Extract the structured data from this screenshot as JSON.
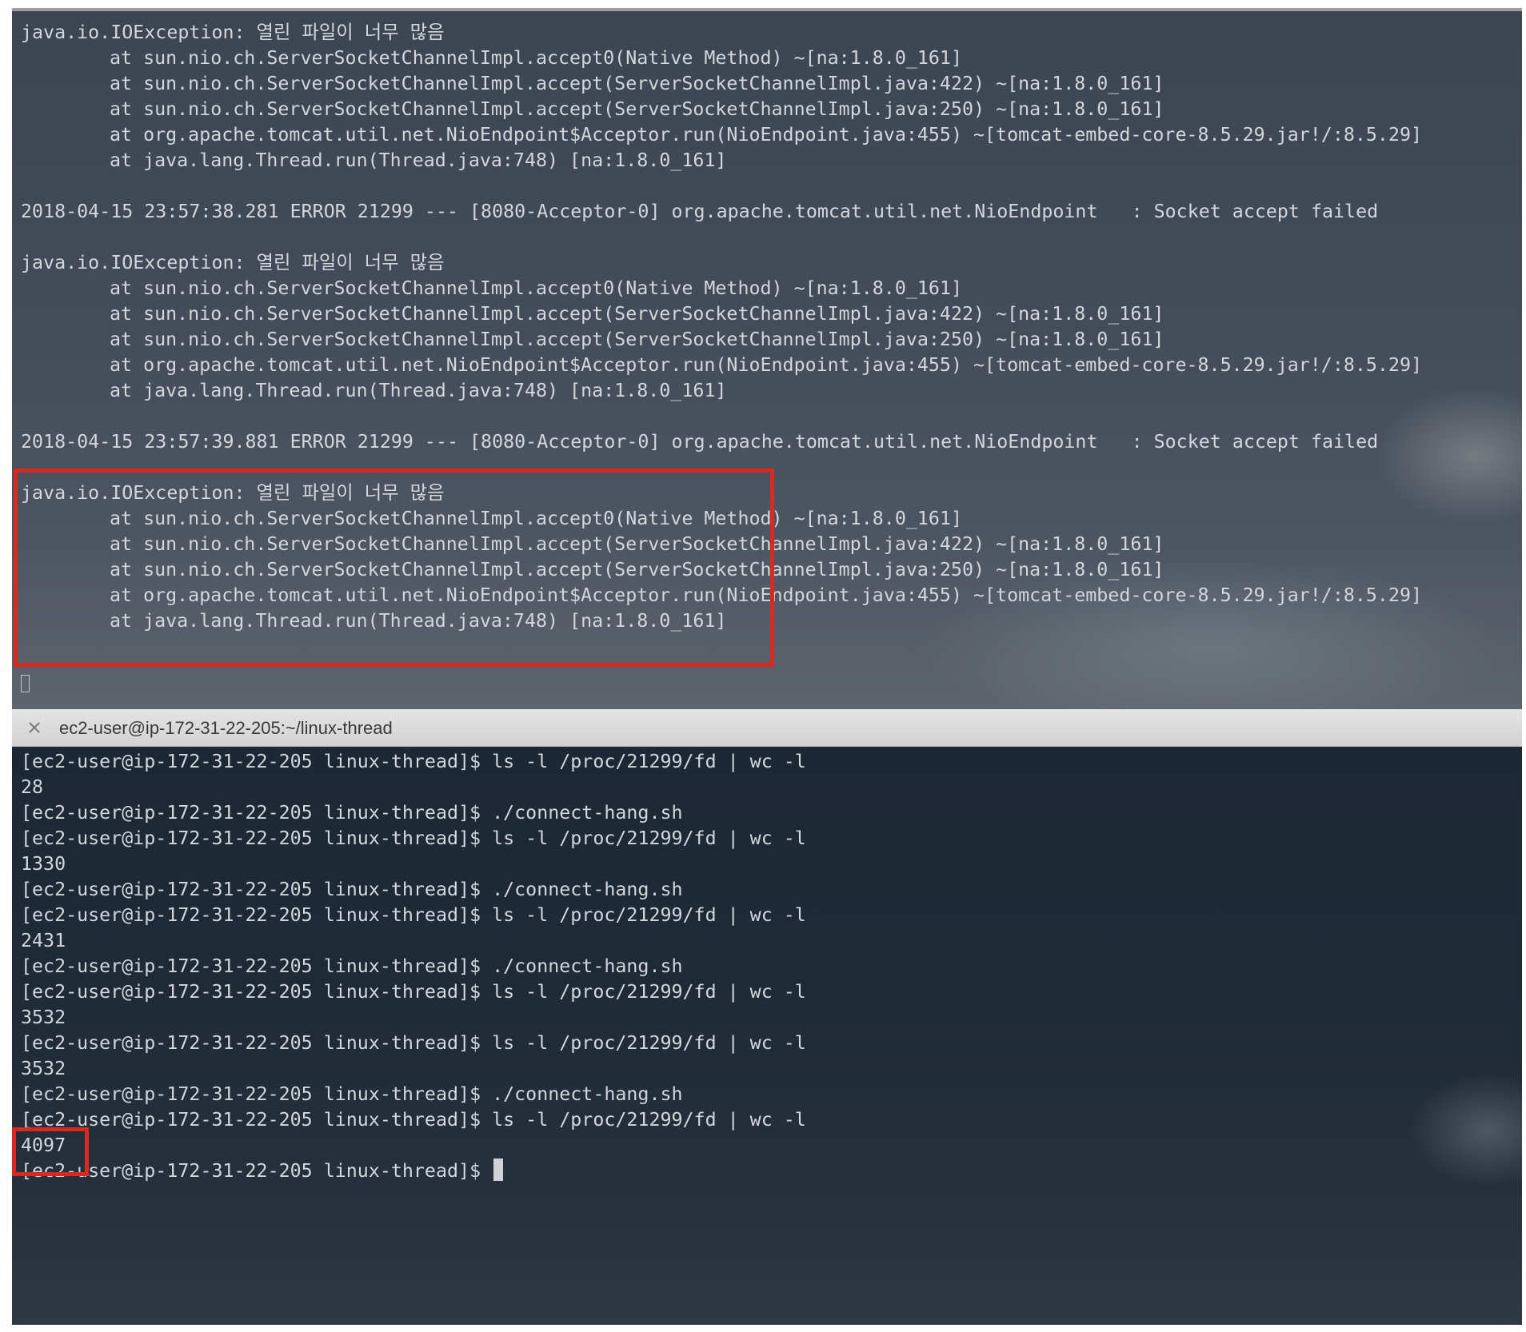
{
  "top_pane": {
    "lines": [
      {
        "text": "java.io.IOException: 열린 파일이 너무 많음",
        "indent": false
      },
      {
        "text": "at sun.nio.ch.ServerSocketChannelImpl.accept0(Native Method) ~[na:1.8.0_161]",
        "indent": true
      },
      {
        "text": "at sun.nio.ch.ServerSocketChannelImpl.accept(ServerSocketChannelImpl.java:422) ~[na:1.8.0_161]",
        "indent": true
      },
      {
        "text": "at sun.nio.ch.ServerSocketChannelImpl.accept(ServerSocketChannelImpl.java:250) ~[na:1.8.0_161]",
        "indent": true
      },
      {
        "text": "at org.apache.tomcat.util.net.NioEndpoint$Acceptor.run(NioEndpoint.java:455) ~[tomcat-embed-core-8.5.29.jar!/:8.5.29]",
        "indent": true
      },
      {
        "text": "at java.lang.Thread.run(Thread.java:748) [na:1.8.0_161]",
        "indent": true
      },
      {
        "text": "",
        "indent": false
      },
      {
        "text": "2018-04-15 23:57:38.281 ERROR 21299 --- [8080-Acceptor-0] org.apache.tomcat.util.net.NioEndpoint   : Socket accept failed",
        "indent": false
      },
      {
        "text": "",
        "indent": false
      },
      {
        "text": "java.io.IOException: 열린 파일이 너무 많음",
        "indent": false
      },
      {
        "text": "at sun.nio.ch.ServerSocketChannelImpl.accept0(Native Method) ~[na:1.8.0_161]",
        "indent": true
      },
      {
        "text": "at sun.nio.ch.ServerSocketChannelImpl.accept(ServerSocketChannelImpl.java:422) ~[na:1.8.0_161]",
        "indent": true
      },
      {
        "text": "at sun.nio.ch.ServerSocketChannelImpl.accept(ServerSocketChannelImpl.java:250) ~[na:1.8.0_161]",
        "indent": true
      },
      {
        "text": "at org.apache.tomcat.util.net.NioEndpoint$Acceptor.run(NioEndpoint.java:455) ~[tomcat-embed-core-8.5.29.jar!/:8.5.29]",
        "indent": true
      },
      {
        "text": "at java.lang.Thread.run(Thread.java:748) [na:1.8.0_161]",
        "indent": true
      },
      {
        "text": "",
        "indent": false
      },
      {
        "text": "2018-04-15 23:57:39.881 ERROR 21299 --- [8080-Acceptor-0] org.apache.tomcat.util.net.NioEndpoint   : Socket accept failed",
        "indent": false
      },
      {
        "text": "",
        "indent": false
      },
      {
        "text": "java.io.IOException: 열린 파일이 너무 많음",
        "indent": false
      },
      {
        "text": "at sun.nio.ch.ServerSocketChannelImpl.accept0(Native Method) ~[na:1.8.0_161]",
        "indent": true
      },
      {
        "text": "at sun.nio.ch.ServerSocketChannelImpl.accept(ServerSocketChannelImpl.java:422) ~[na:1.8.0_161]",
        "indent": true
      },
      {
        "text": "at sun.nio.ch.ServerSocketChannelImpl.accept(ServerSocketChannelImpl.java:250) ~[na:1.8.0_161]",
        "indent": true
      },
      {
        "text": "at org.apache.tomcat.util.net.NioEndpoint$Acceptor.run(NioEndpoint.java:455) ~[tomcat-embed-core-8.5.29.jar!/:8.5.29]",
        "indent": true
      },
      {
        "text": "at java.lang.Thread.run(Thread.java:748) [na:1.8.0_161]",
        "indent": true
      }
    ]
  },
  "tab": {
    "close_icon": "close-icon",
    "title": "ec2-user@ip-172-31-22-205:~/linux-thread"
  },
  "bottom_pane": {
    "lines": [
      {
        "text": "[ec2-user@ip-172-31-22-205 linux-thread]$ ls -l /proc/21299/fd | wc -l"
      },
      {
        "text": "28"
      },
      {
        "text": "[ec2-user@ip-172-31-22-205 linux-thread]$ ./connect-hang.sh"
      },
      {
        "text": "[ec2-user@ip-172-31-22-205 linux-thread]$ ls -l /proc/21299/fd | wc -l"
      },
      {
        "text": "1330"
      },
      {
        "text": "[ec2-user@ip-172-31-22-205 linux-thread]$ ./connect-hang.sh"
      },
      {
        "text": "[ec2-user@ip-172-31-22-205 linux-thread]$ ls -l /proc/21299/fd | wc -l"
      },
      {
        "text": "2431"
      },
      {
        "text": "[ec2-user@ip-172-31-22-205 linux-thread]$ ./connect-hang.sh"
      },
      {
        "text": "[ec2-user@ip-172-31-22-205 linux-thread]$ ls -l /proc/21299/fd | wc -l"
      },
      {
        "text": "3532"
      },
      {
        "text": "[ec2-user@ip-172-31-22-205 linux-thread]$ ls -l /proc/21299/fd | wc -l"
      },
      {
        "text": "3532"
      },
      {
        "text": "[ec2-user@ip-172-31-22-205 linux-thread]$ ./connect-hang.sh"
      },
      {
        "text": "[ec2-user@ip-172-31-22-205 linux-thread]$ ls -l /proc/21299/fd | wc -l"
      },
      {
        "text": "4097"
      }
    ],
    "prompt": "[ec2-user@ip-172-31-22-205 linux-thread]$ "
  },
  "colors": {
    "highlight": "#d92a20",
    "terminal_text": "#d3d6da"
  }
}
